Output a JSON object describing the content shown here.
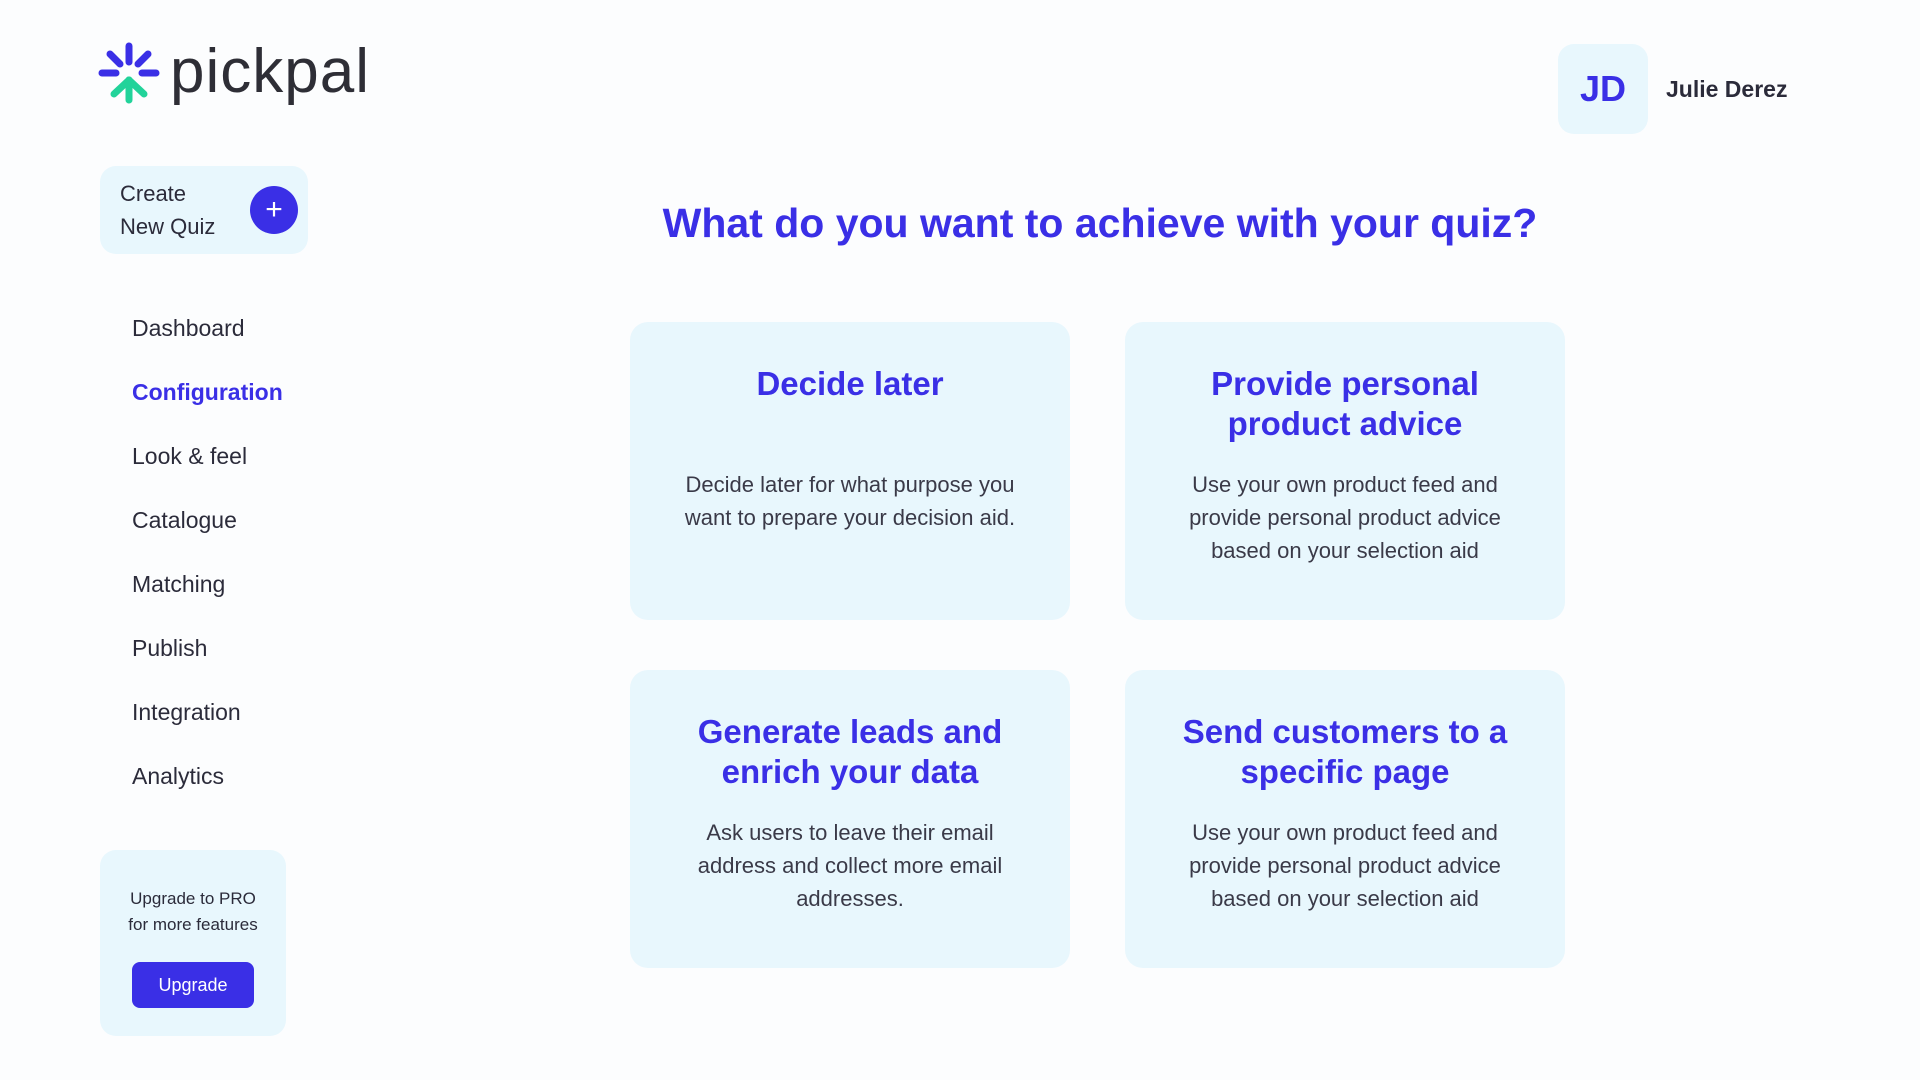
{
  "brand": {
    "name": "pickpal",
    "accent": "#3a2fe6",
    "accent_secondary": "#22d39a",
    "surface": "#e8f7fd"
  },
  "user": {
    "initials": "JD",
    "name": "Julie Derez"
  },
  "sidebar": {
    "create_label_line1": "Create",
    "create_label_line2": "New Quiz",
    "create_icon": "plus-icon",
    "items": [
      {
        "label": "Dashboard",
        "active": false
      },
      {
        "label": "Configuration",
        "active": true
      },
      {
        "label": "Look & feel",
        "active": false
      },
      {
        "label": "Catalogue",
        "active": false
      },
      {
        "label": "Matching",
        "active": false
      },
      {
        "label": "Publish",
        "active": false
      },
      {
        "label": "Integration",
        "active": false
      },
      {
        "label": "Analytics",
        "active": false
      }
    ],
    "upgrade": {
      "text_line1": "Upgrade to PRO",
      "text_line2": "for more features",
      "button_label": "Upgrade"
    }
  },
  "main": {
    "title": "What do you want to achieve with your quiz?",
    "cards": [
      {
        "title": "Decide later",
        "description": "Decide later for what purpose you want to prepare your decision aid."
      },
      {
        "title": "Provide personal product advice",
        "description": "Use your own product feed and provide personal product advice based on your selection aid"
      },
      {
        "title": "Generate leads and enrich your data",
        "description": "Ask users to leave their email address and collect more email addresses."
      },
      {
        "title": "Send customers to a specific page",
        "description": "Use your own product feed and provide personal product advice based on your selection aid"
      }
    ]
  }
}
